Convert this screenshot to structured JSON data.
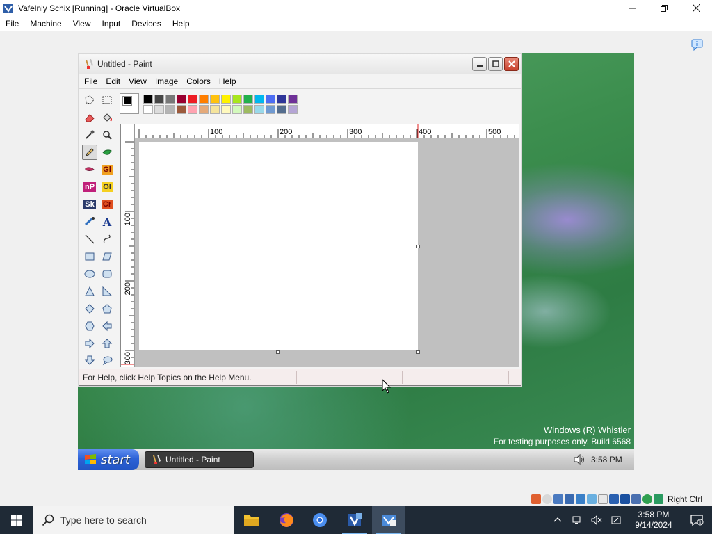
{
  "host": {
    "title": "Vafelniy  Schix [Running] - Oracle VirtualBox",
    "menu": [
      "File",
      "Machine",
      "View",
      "Input",
      "Devices",
      "Help"
    ],
    "hostkey": "Right Ctrl"
  },
  "paint": {
    "title": "Untitled - Paint",
    "menu": [
      "File",
      "Edit",
      "View",
      "Image",
      "Colors",
      "Help"
    ],
    "status": "For Help, click Help Topics on the Help Menu.",
    "ruler_top": [
      "100",
      "200",
      "300",
      "400",
      "500"
    ],
    "ruler_left": [
      "100",
      "200",
      "300"
    ],
    "tool_labels": {
      "gl": "Gl",
      "np": "nP",
      "ol": "Ol",
      "sk": "Sk",
      "cr": "Cr",
      "text": "A"
    },
    "palette_top": [
      "#000000",
      "#464646",
      "#787878",
      "#990030",
      "#ed1c24",
      "#ff7e00",
      "#ffc20e",
      "#fff200",
      "#a8e61d",
      "#22b14c",
      "#00b7ef",
      "#4d6df3",
      "#2f3699",
      "#6f3198"
    ],
    "palette_bottom": [
      "#ffffff",
      "#dcdcdc",
      "#b4b4b4",
      "#9c5a3c",
      "#ffa3b1",
      "#e5aa7a",
      "#f5e49c",
      "#fff9bd",
      "#d3f9bc",
      "#9dbb61",
      "#99d9ea",
      "#709ad1",
      "#546d8e",
      "#b5a5d5"
    ]
  },
  "guest_taskbar": {
    "start": "start",
    "task": "Untitled - Paint",
    "clock": "3:58 PM"
  },
  "watermark": {
    "line1": "Windows (R) Whistler",
    "line2": "For testing purposes only. Build 6568"
  },
  "win_taskbar": {
    "search_placeholder": "Type here to search",
    "time": "3:58 PM",
    "date": "9/14/2024",
    "notif_count": "1"
  }
}
